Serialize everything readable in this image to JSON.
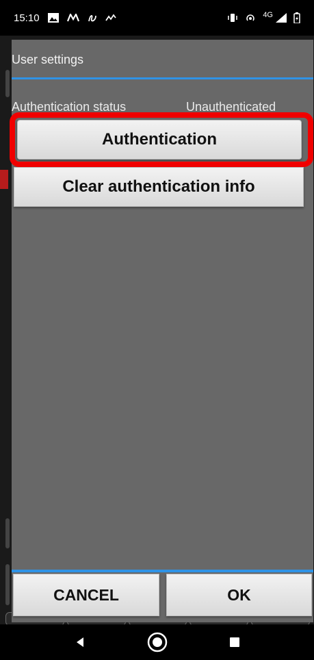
{
  "status_bar": {
    "time": "15:10",
    "network": "4G",
    "left_icons": [
      "image-icon",
      "m-logo-icon",
      "app-icon",
      "signal-alt-icon"
    ],
    "right_icons": [
      "vibrate-icon",
      "hotspot-icon",
      "signal-icon",
      "battery-icon"
    ]
  },
  "dialog": {
    "title": "User settings",
    "auth_status_label": "Authentication status",
    "auth_status_value": "Unauthenticated",
    "auth_button": "Authentication",
    "clear_button": "Clear authentication info",
    "cancel_button": "CANCEL",
    "ok_button": "OK"
  },
  "colors": {
    "accent": "#2f93e6",
    "highlight": "#f00000",
    "dialog_bg": "#686868"
  },
  "nav": {
    "back": "back-icon",
    "home": "home-icon",
    "recents": "recents-icon"
  }
}
